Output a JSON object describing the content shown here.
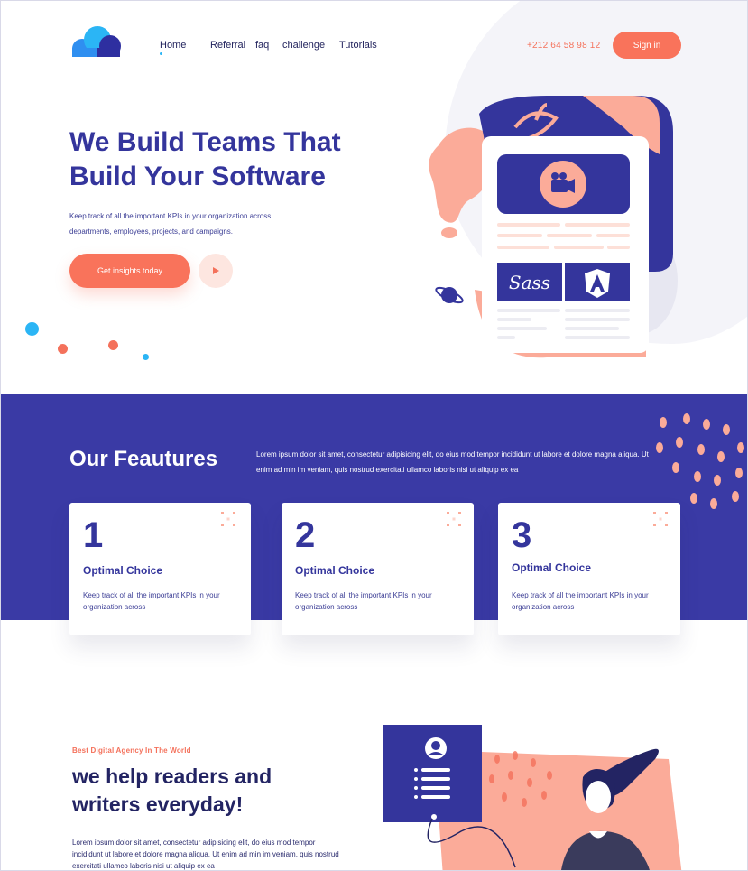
{
  "header": {
    "nav": [
      "Home",
      "Referral",
      "faq",
      "challenge",
      "Tutorials"
    ],
    "phone": "+212 64 58 98 12",
    "signin_label": "Sign in"
  },
  "hero": {
    "title_line1": "We Build Teams That",
    "title_line2": "Build Your Software",
    "description_line1": "Keep track of all the important KPIs in your organization across",
    "description_line2": "departments, employees, projects, and campaigns.",
    "cta_label": "Get insights today"
  },
  "features": {
    "title": "Our Feautures",
    "description": "Lorem ipsum dolor sit amet, consectetur adipisicing elit, do eius mod  tempor incididunt ut labore et dolore magna aliqua. Ut enim ad min im veniam, quis nostrud exercitati ullamco laboris nisi ut aliquip ex ea",
    "cards": [
      {
        "number": "1",
        "title": "Optimal Choice",
        "desc": "Keep track of all the important KPIs in your organization across"
      },
      {
        "number": "2",
        "title": "Optimal Choice",
        "desc": "Keep track of all the important KPIs in your organization across"
      },
      {
        "number": "3",
        "title": "Optimal Choice",
        "desc": "Keep track of all the important KPIs in your organization across"
      }
    ]
  },
  "agency": {
    "eyebrow": "Best Digital Agency In The World",
    "title_line1": "we help readers and",
    "title_line2": "writers everyday!",
    "description": "Lorem ipsum dolor sit amet, consectetur adipisicing elit, do eius mod tempor incididunt ut labore et dolore magna aliqua. Ut enim ad min im veniam, quis nostrud exercitati ullamco laboris nisi ut aliquip ex ea"
  },
  "illustration": {
    "sass_label": "Sass"
  },
  "colors": {
    "primary": "#3a3aa5",
    "accent": "#f9735b",
    "peach": "#fbab99",
    "sky": "#2bb5f5"
  },
  "icons": [
    "cloud-logo-icon",
    "play-icon",
    "video-camera-icon",
    "planet-icon",
    "sass-logo-icon",
    "angular-logo-icon",
    "user-avatar-icon",
    "list-icon"
  ]
}
